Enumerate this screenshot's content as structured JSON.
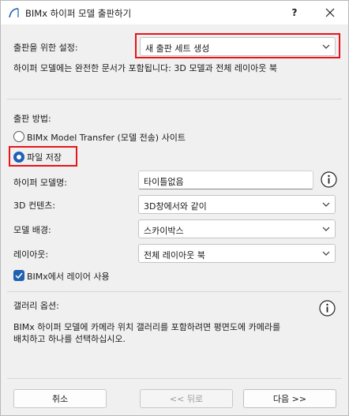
{
  "window": {
    "title": "BIMx 하이퍼 모델 출판하기",
    "help_label": "?"
  },
  "publish_settings": {
    "label": "출판을 위한 설정:",
    "selected": "새 출판 세트 생성",
    "description": "하이퍼 모델에는 완전한 문서가 포함됩니다: 3D 모델과 전체 레이아웃 북"
  },
  "publish_method": {
    "label": "출판 방법:",
    "options": [
      {
        "label": "BIMx Model Transfer (모델 전송) 사이트",
        "selected": false
      },
      {
        "label": "파일 저장",
        "selected": true
      }
    ]
  },
  "fields": {
    "model_name": {
      "label": "하이퍼 모델명:",
      "value": "타이틀없음"
    },
    "content_3d": {
      "label": "3D 컨텐츠:",
      "value": "3D창에서와 같이"
    },
    "background": {
      "label": "모델 배경:",
      "value": "스카이박스"
    },
    "layout": {
      "label": "레이아웃:",
      "value": "전체 레이아웃 북"
    }
  },
  "use_bimx_layers": {
    "label": "BIMx에서 레이어 사용",
    "checked": true
  },
  "gallery": {
    "label": "갤러리 옵션:",
    "description_line1": "BIMx 하이퍼 모델에 카메라 위치 갤러리를 포함하려면 평면도에 카메라를",
    "description_line2": "배치하고 하나를 선택하십시오."
  },
  "buttons": {
    "cancel": "취소",
    "back": "<< 뒤로",
    "next": "다음 >>"
  },
  "colors": {
    "accent": "#1f5fb4",
    "highlight": "#e8141b"
  }
}
